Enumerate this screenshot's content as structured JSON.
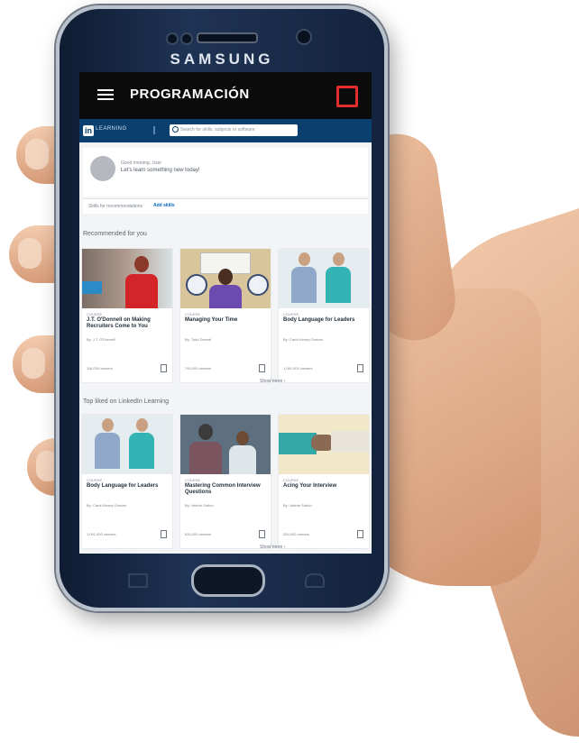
{
  "phone": {
    "brand": "SAMSUNG"
  },
  "appbar": {
    "title": "PROGRAMACIÓN"
  },
  "linkedin": {
    "logo_in": "in",
    "logo_text": "LEARNING",
    "search_placeholder": "Search for skills, subjects or software"
  },
  "welcome": {
    "greeting": "Good morning, User",
    "prompt": "Let's learn something new today!",
    "skills_label": "Skills for recommendations",
    "add_skills": "Add skills"
  },
  "recommended": {
    "title": "Recommended for you",
    "see_more": "Show more  ›",
    "cards": [
      {
        "kind": "COURSE",
        "title": "J.T. O'Donnell on Making Recruiters Come to You",
        "author": "By: J.T. O'Donnell",
        "views": "118,000 viewers"
      },
      {
        "kind": "COURSE",
        "title": "Managing Your Time",
        "author": "By: Todd Dewett",
        "views": "794,000 viewers"
      },
      {
        "kind": "COURSE",
        "title": "Body Language for Leaders",
        "author": "By: Carol Kinsey Goman",
        "views": "1,091,000 viewers"
      }
    ]
  },
  "top_learning": {
    "title": "Top liked on LinkedIn Learning",
    "see_more": "Show more  ›",
    "cards": [
      {
        "kind": "COURSE",
        "title": "Body Language for Leaders",
        "author": "By: Carol Kinsey Goman",
        "views": "1,091,000 viewers"
      },
      {
        "kind": "COURSE",
        "title": "Mastering Common Interview Questions",
        "author": "By: Valerie Sutton",
        "views": "834,000 viewers"
      },
      {
        "kind": "COURSE",
        "title": "Acing Your Interview",
        "author": "By: Valerie Sutton",
        "views": "334,000 viewers"
      }
    ]
  }
}
